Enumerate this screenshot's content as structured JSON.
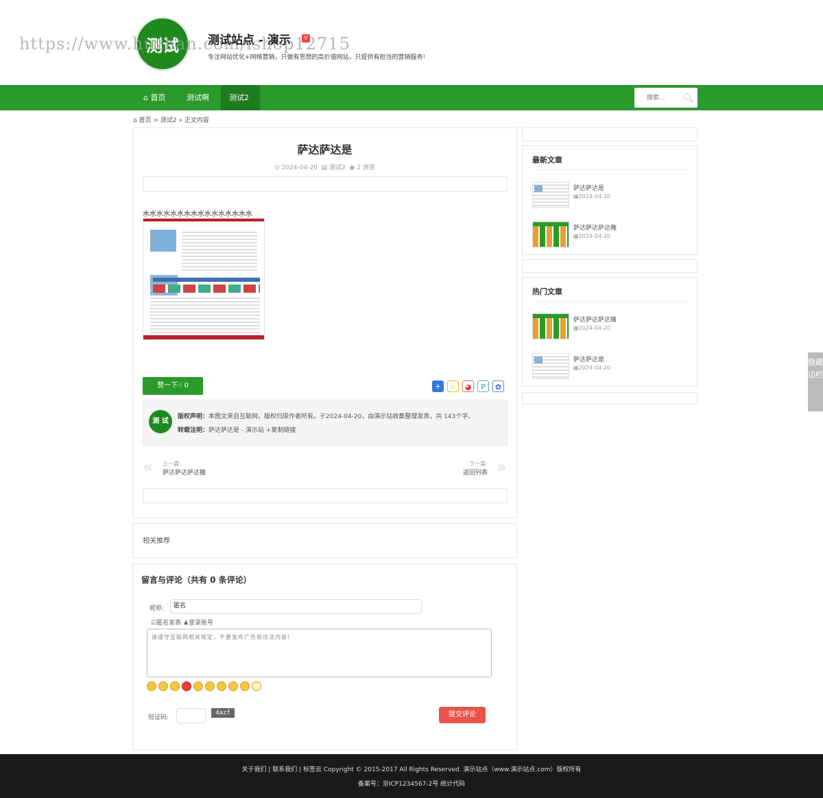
{
  "header": {
    "logo_text": "测试",
    "watermark": "https://www.huzhan.com/ishop12715",
    "site_title": "测试站点 - 演示",
    "site_desc": "专注网站优化+网络营销，只做有思想的高价值网站，只提供有担当的营销服务!"
  },
  "nav": {
    "items": [
      {
        "label": "首页",
        "icon": "home-icon"
      },
      {
        "label": "测试啊"
      },
      {
        "label": "测试2",
        "active": true
      }
    ],
    "search_placeholder": "搜索..."
  },
  "breadcrumb": {
    "home": "首页",
    "sep1": ">",
    "category": "测试2",
    "sep2": "»",
    "current": "正文内容"
  },
  "article": {
    "title": "萨达萨达是",
    "date": "2024-04-20",
    "category": "测试2",
    "views": "2 浏览",
    "body_text": "水水水水水水水水水水水水水水水水",
    "like_label": "赞一下",
    "like_count": "0",
    "share_icons": [
      "plus-share-icon",
      "qzone-share-icon",
      "weibo-share-icon",
      "tencent-share-icon",
      "baidu-share-icon"
    ]
  },
  "copyright": {
    "logo_text": "测 试",
    "line1_label": "版权声明：",
    "line1_text": "本图文来自互联网，版权归原作者所有。于2024-04-20，由演示站收集整理发表，共 143个字。",
    "line2_label": "转载注明：",
    "line2_text": "萨达萨达是 - 演示站 +复制链接"
  },
  "prev_next": {
    "prev_label": "上一篇:",
    "prev_title": "萨达萨达萨达撒",
    "next_label": "下一篇:",
    "next_title": "返回列表"
  },
  "related": {
    "title": "相关推荐"
  },
  "comments": {
    "title": "留言与评论（共有 0 条评论）",
    "nickname_label": "昵称:",
    "nickname_value": "匿名",
    "anonymous_label": "匿名发表",
    "login_label": "登录账号",
    "textarea_placeholder": "请遵守互联网相关规定，不要发布广告和违法内容!",
    "captcha_label": "验证码:",
    "captcha_text": "4azf",
    "submit_label": "提交评论"
  },
  "sidebar": {
    "latest_title": "最新文章",
    "latest": [
      {
        "title": "萨达萨达是",
        "date": "2024-04-20"
      },
      {
        "title": "萨达萨达萨达撒",
        "date": "2024-04-20"
      }
    ],
    "hot_title": "热门文章",
    "hot": [
      {
        "title": "萨达萨达萨达撒",
        "date": "2024-04-20"
      },
      {
        "title": "萨达萨达是",
        "date": "2024-04-20"
      }
    ],
    "hide_label": "隐藏边栏"
  },
  "footer": {
    "line1": "关于我们 | 联系我们 | 标签云 Copyright © 2015-2017 All Rights Reserved. 演示站点（www.演示站点.com）版权所有",
    "line2": "备案号：京ICP1234567-2号 统计代码"
  },
  "colors": {
    "brand_green": "#2a9a2a",
    "nav_active": "#1f7b1f",
    "submit_red": "#e8534a",
    "footer_bg": "#1a1a1a"
  }
}
